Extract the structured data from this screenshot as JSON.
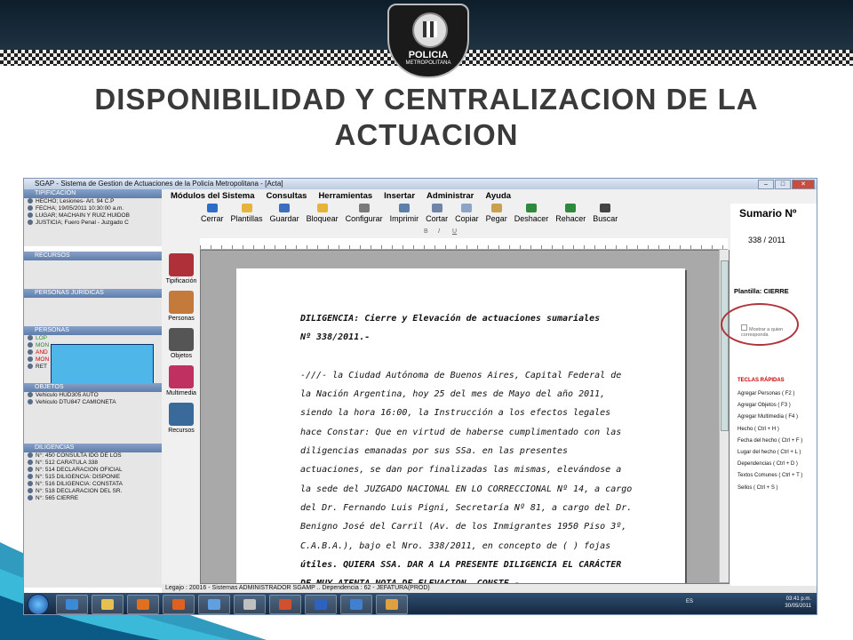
{
  "slide": {
    "title_line1": "DISPONIBILIDAD Y CENTRALIZACION DE LA",
    "title_line2": "ACTUACION",
    "badge_text": "POLICIA",
    "badge_subtext": "METROPOLITANA"
  },
  "window": {
    "title": "SGAP  -  Sistema de Gestion de Actuaciones de la Policía Metropolitana - [Acta]"
  },
  "menu": [
    "Módulos del Sistema",
    "Consultas",
    "Herramientas",
    "Insertar",
    "Administrar",
    "Ayuda"
  ],
  "toolbar": [
    {
      "label": "Cerrar",
      "icon": "arrow-left-icon",
      "color": "#2b6fc8"
    },
    {
      "label": "Plantillas",
      "icon": "folder-icon",
      "color": "#e6b43a"
    },
    {
      "label": "Guardar",
      "icon": "disk-icon",
      "color": "#3a6ec0"
    },
    {
      "label": "Bloquear",
      "icon": "folder-lock-icon",
      "color": "#e6b43a"
    },
    {
      "label": "Configurar",
      "icon": "settings-icon",
      "color": "#7a7a7a"
    },
    {
      "label": "Imprimir",
      "icon": "printer-icon",
      "color": "#5d7fa8"
    },
    {
      "label": "Cortar",
      "icon": "scissors-icon",
      "color": "#6e84a8"
    },
    {
      "label": "Copiar",
      "icon": "copy-icon",
      "color": "#8da4c8"
    },
    {
      "label": "Pegar",
      "icon": "paste-icon",
      "color": "#c8a050"
    },
    {
      "label": "Deshacer",
      "icon": "undo-icon",
      "color": "#2d8a3a"
    },
    {
      "label": "Rehacer",
      "icon": "redo-icon",
      "color": "#2d8a3a"
    },
    {
      "label": "Buscar",
      "icon": "binoculars-icon",
      "color": "#444"
    }
  ],
  "modules": [
    {
      "label": "Tipificación",
      "icon": "book-icon",
      "color": "#b0303a"
    },
    {
      "label": "Personas",
      "icon": "people-icon",
      "color": "#c47a3a"
    },
    {
      "label": "Objetos",
      "icon": "objects-icon",
      "color": "#555"
    },
    {
      "label": "Multimedia",
      "icon": "multimedia-icon",
      "color": "#c03060"
    },
    {
      "label": "Recursos",
      "icon": "resources-icon",
      "color": "#3a6a9a"
    }
  ],
  "left": {
    "tipificacion_header": "TIPIFICACIÓN",
    "tipificacion_items": [
      "HECHO; Lesiones- Art. 94 C.P",
      "FECHA;  19/05/2011 10:30:00 a.m.",
      "LUGAR; MACHAIN Y RUIZ HUIDOB",
      "JUSTICIA; Fuero Penal - Juzgado C"
    ],
    "recursos_header": "RECURSOS",
    "juridicas_header": "PERSONAS JURÍDICAS",
    "personas_header": "PERSONAS",
    "personas_items": [
      {
        "text": "LOP",
        "color": "green"
      },
      {
        "text": "MON",
        "color": "green"
      },
      {
        "text": "AND",
        "color": "red"
      },
      {
        "text": "MON",
        "color": "red"
      },
      {
        "text": "RET",
        "color": "black"
      }
    ],
    "objetos_header": "OBJETOS",
    "objetos_items": [
      "Vehiculo   HUD305 AUTO",
      "Vehiculo   DTU847 CAMIONETA"
    ],
    "diligencias_header": "DILIGENCIAS",
    "diligencias_items": [
      "N°: 450 CONSULTA IDG DE LOS",
      "N°: 512 CARATULA 338",
      "N°: 514 DECLARACION OFICIAL",
      "N°: 515 DILIGENCIA: DISPONIE",
      "N°: 516 DILIGENCIA: CONSTATA",
      "N°: 518 DECLARACION DEL SR.",
      "N°: 565 CIERRE"
    ]
  },
  "document": {
    "lines": [
      "DILIGENCIA: Cierre y Elevación de actuaciones sumariales",
      "Nº 338/2011.-",
      "",
      "-///- la Ciudad  Autónoma de Buenos Aires, Capital Federal de",
      "la Nación Argentina, hoy 25 del mes de Mayo del año 2011,",
      "siendo la hora 16:00, la Instrucción a los efectos legales",
      "hace Constar: Que en virtud de haberse cumplimentado con las",
      "diligencias   emanadas   por   sus   SSa.  en  las  presentes",
      "actuaciones, se dan por finalizadas las mismas, elevándose a",
      "la sede del JUZGADO NACIONAL EN LO CORRECCIONAL Nº 14, a cargo",
      "del Dr. Fernando Luis Pigni, Secretaría Nº 81, a cargo del Dr.",
      "Benigno José del Carril (Av. de los Inmigrantes 1950 Piso 3º,",
      "C.A.B.A.), bajo el Nro. 338/2011, en concepto de (    ) fojas",
      "útiles. QUIERA SSA. DAR A LA PRESENTE DILIGENCIA EL CARÁCTER",
      "DE MUY ATENTA NOTA DE ELEVACION. CONSTE.-"
    ]
  },
  "status_bar": "Legajo : 20016 - Sistemas ADMINISTRADOR SGAMP .. Dependencia : 62 - JEFATURA(PROD)",
  "right": {
    "sumario_label": "Sumario Nº",
    "sumario_number": "338 / 2011",
    "plantilla": "Plantilla: CIERRE",
    "checkbox_label": "Mostrar a quien corresponda",
    "teclas_header": "TECLAS RÁPIDAS",
    "shortcuts": [
      "Agregar Personas ( F2 )",
      "Agregar Objetos ( F3 )",
      "Agregar Multimedia ( F4 )",
      "Hecho ( Ctrl + H )",
      "Fecha del hecho ( Ctrl + F )",
      "Lugar del hecho ( Ctrl + L )",
      "Dependencias ( Ctrl + D )",
      "Textos Comunes ( Ctrl + T )",
      "Sellos ( Ctrl + S )"
    ]
  },
  "taskbar": {
    "lang": "ES",
    "time": "03:41 p.m.",
    "date": "30/05/2011",
    "apps": [
      {
        "icon": "ie-icon",
        "color": "#3a8ad8"
      },
      {
        "icon": "explorer-icon",
        "color": "#e8c050"
      },
      {
        "icon": "media-player-icon",
        "color": "#e07020"
      },
      {
        "icon": "firefox-icon",
        "color": "#e06020"
      },
      {
        "icon": "messenger-icon",
        "color": "#60a0e0"
      },
      {
        "icon": "tool-icon",
        "color": "#c0c0c0"
      },
      {
        "icon": "powerpoint-icon",
        "color": "#d05030"
      },
      {
        "icon": "word-icon",
        "color": "#3060c0"
      },
      {
        "icon": "window-icon",
        "color": "#4080d0"
      },
      {
        "icon": "app-icon",
        "color": "#e0a040"
      }
    ]
  },
  "colors": {
    "accent_oval": "#b0343b",
    "section_header": "#5f7eab",
    "slide_title": "#3a3a3a"
  }
}
